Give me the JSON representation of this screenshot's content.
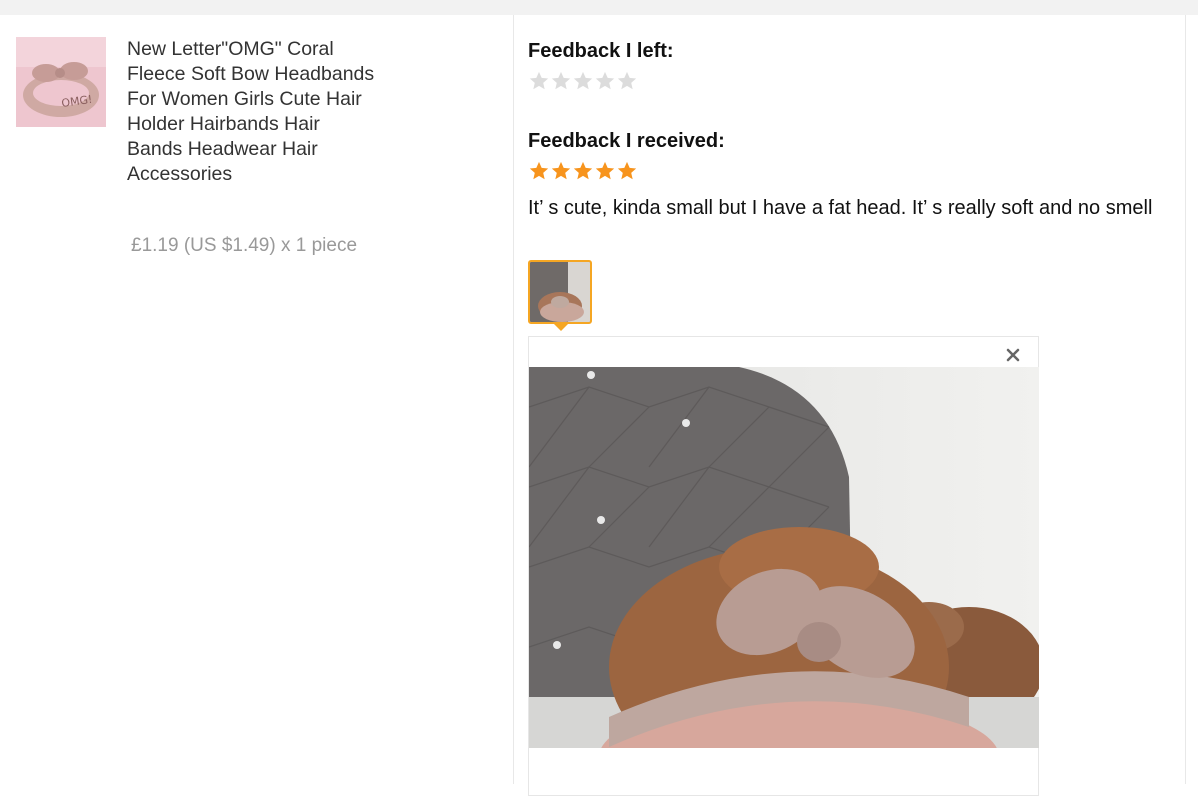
{
  "product": {
    "title": "New Letter\"OMG\" Coral Fleece Soft Bow Headbands For Women Girls Cute Hair Holder Hairbands Hair Bands Headwear Hair Accessories",
    "price": "£1.19 (US $1.49) x 1 piece",
    "thumb_icon": "headband-photo",
    "thumb_text": "OMG!"
  },
  "feedback_left": {
    "heading": "Feedback I left:",
    "rating": 0,
    "max": 5
  },
  "feedback_received": {
    "heading": "Feedback I received:",
    "rating": 5,
    "max": 5,
    "comment": "It’ s cute, kinda small but I have a fat head. It’ s really soft and no smell"
  },
  "preview": {
    "close_icon": "close-icon"
  },
  "colors": {
    "star_active": "#f7941d",
    "star_inactive": "#dcdcdc",
    "thumb_border": "#f5a623",
    "price": "#999999"
  }
}
